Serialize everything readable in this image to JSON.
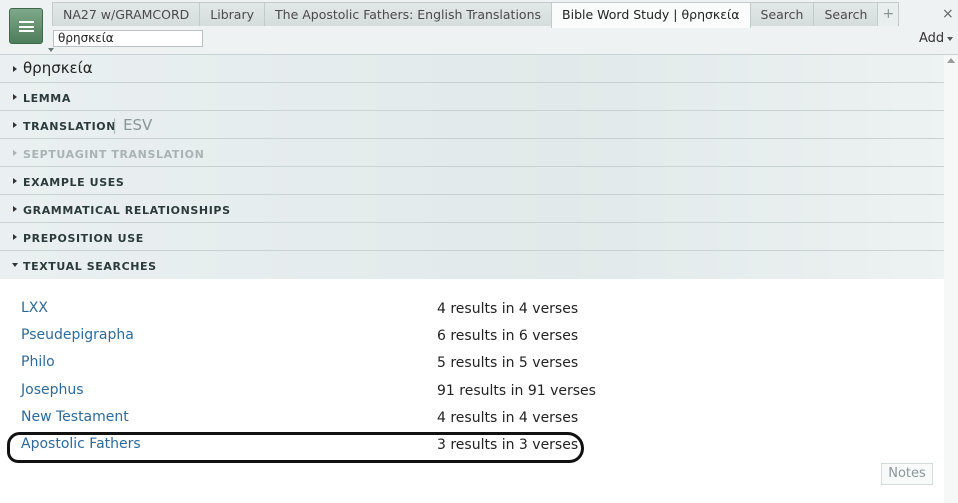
{
  "tabs": [
    {
      "label": "NA27 w/GRAMCORD"
    },
    {
      "label": "Library"
    },
    {
      "label": "The Apostolic Fathers: English Translations"
    },
    {
      "label": "Bible Word Study | θρησκεία",
      "active": true
    },
    {
      "label": "Search"
    },
    {
      "label": "Search"
    }
  ],
  "tab_add": "+",
  "close": "×",
  "search": {
    "value": "θρησκεία"
  },
  "add_label": "Add",
  "sections": {
    "headword": "θρησκεία",
    "lemma": "LEMMA",
    "translation": "TRANSLATION",
    "translation_sep": "|",
    "translation_value": "ESV",
    "septuagint": "SEPTUAGINT TRANSLATION",
    "example_uses": "EXAMPLE USES",
    "grammatical": "GRAMMATICAL RELATIONSHIPS",
    "preposition": "PREPOSITION USE",
    "textual_searches": "TEXTUAL SEARCHES"
  },
  "results": [
    {
      "name": "LXX",
      "count": "4 results in 4 verses"
    },
    {
      "name": "Pseudepigrapha",
      "count": "6 results in 6 verses"
    },
    {
      "name": "Philo",
      "count": "5 results in 5 verses"
    },
    {
      "name": "Josephus",
      "count": "91 results in 91 verses"
    },
    {
      "name": "New Testament",
      "count": "4 results in 4 verses"
    },
    {
      "name": "Apostolic Fathers",
      "count": "3 results in 3 verses"
    }
  ],
  "notes_label": "Notes",
  "colors": {
    "accent_link": "#2e6a99",
    "menu_button": "#5a8a66"
  }
}
